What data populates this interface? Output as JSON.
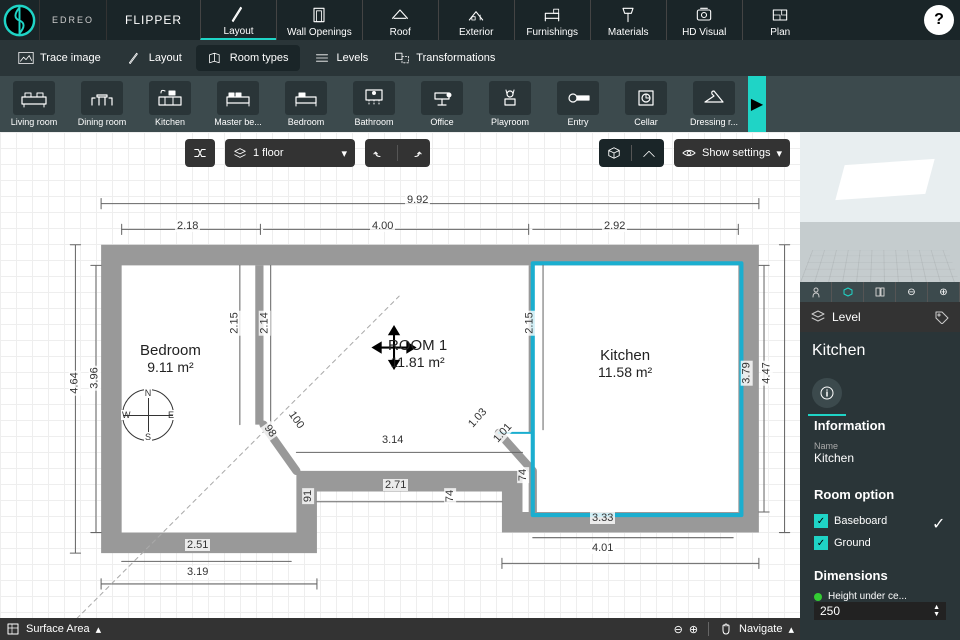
{
  "brand": "EDREO",
  "project_name": "FLIPPER",
  "main_nav": [
    {
      "label": "Layout",
      "name": "nav-layout",
      "active": true
    },
    {
      "label": "Wall Openings",
      "name": "nav-wall-openings"
    },
    {
      "label": "Roof",
      "name": "nav-roof"
    },
    {
      "label": "Exterior",
      "name": "nav-exterior"
    },
    {
      "label": "Furnishings",
      "name": "nav-furnishings"
    },
    {
      "label": "Materials",
      "name": "nav-materials"
    },
    {
      "label": "HD Visual",
      "name": "nav-hd-visual"
    },
    {
      "label": "Plan",
      "name": "nav-plan"
    }
  ],
  "sub_nav": [
    {
      "label": "Trace image",
      "name": "tab-trace"
    },
    {
      "label": "Layout",
      "name": "tab-layout"
    },
    {
      "label": "Room types",
      "name": "tab-room-types",
      "active": true
    },
    {
      "label": "Levels",
      "name": "tab-levels"
    },
    {
      "label": "Transformations",
      "name": "tab-transformations"
    }
  ],
  "room_thumbs": [
    {
      "label": "Living room"
    },
    {
      "label": "Dining room"
    },
    {
      "label": "Kitchen"
    },
    {
      "label": "Master be..."
    },
    {
      "label": "Bedroom"
    },
    {
      "label": "Bathroom"
    },
    {
      "label": "Office"
    },
    {
      "label": "Playroom"
    },
    {
      "label": "Entry"
    },
    {
      "label": "Cellar"
    },
    {
      "label": "Dressing r..."
    }
  ],
  "floor_select": "1 floor",
  "show_settings": "Show settings",
  "floorplan": {
    "top_total": "9.92",
    "top_segments": [
      "2.18",
      "4.00",
      "2.92"
    ],
    "left_outer": "4.64",
    "left_inner": "3.96",
    "right_inner": "3.79",
    "right_outer": "4.47",
    "mid_v1": "2.15",
    "mid_v2": "2.14",
    "mid_v3": "2.15",
    "bot_mid": "3.14",
    "bot_mid2": "2.71",
    "bot_left": "3.19",
    "bot_left_in": "2.51",
    "bot_right_in": "3.33",
    "bot_right": "4.01",
    "diag1": "98",
    "diag2": "100",
    "diag3": "1.03",
    "diag4": "1.01",
    "small1": "91",
    "small2": "74",
    "small3": "74",
    "rooms": [
      {
        "name": "Bedroom",
        "area": "9.11 m²"
      },
      {
        "name": "ROOM 1",
        "area": "11.81 m²"
      },
      {
        "name": "Kitchen",
        "area": "11.58 m²"
      }
    ]
  },
  "bottom_bar": {
    "surface": "Surface Area",
    "nav": "Navigate"
  },
  "side": {
    "panel_label": "Level",
    "room_name": "Kitchen",
    "info_heading": "Information",
    "name_label": "Name",
    "name_value": "Kitchen",
    "roomopt_heading": "Room option",
    "opts": [
      {
        "label": "Baseboard",
        "checked": true
      },
      {
        "label": "Ground",
        "checked": true
      }
    ],
    "dim_heading": "Dimensions",
    "height_label": "Height under ce...",
    "height_value": "250"
  }
}
